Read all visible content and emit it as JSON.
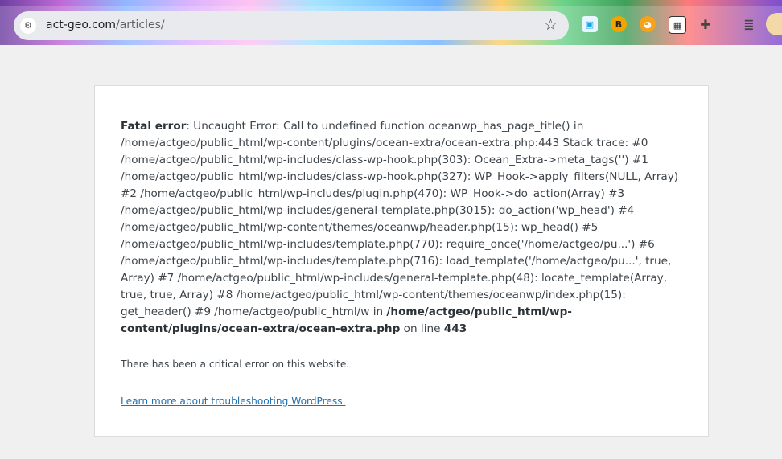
{
  "browser": {
    "url_host": "act-geo.com",
    "url_path": "/articles/",
    "extensions": [
      {
        "icon": "extension-icon-blue-square",
        "glyph": "▣",
        "color": "#1aa3e8"
      },
      {
        "icon": "extension-icon-b-badge",
        "glyph": "B",
        "color": "#f0a500"
      },
      {
        "icon": "extension-icon-orange-face",
        "glyph": "◕",
        "color": "#f7a21b"
      },
      {
        "icon": "extension-icon-qr",
        "glyph": "▦",
        "color": "#333333"
      },
      {
        "icon": "puzzle-piece-icon",
        "glyph": "✚",
        "color": "#444444"
      },
      {
        "icon": "media-playlist-icon",
        "glyph": "≣",
        "color": "#444444"
      }
    ]
  },
  "error": {
    "label": "Fatal error",
    "message": ": Uncaught Error: Call to undefined function oceanwp_has_page_title() in /home/actgeo/public_html/wp-content/plugins/ocean-extra/ocean-extra.php:443 Stack trace: #0 /home/actgeo/public_html/wp-includes/class-wp-hook.php(303): Ocean_Extra->meta_tags('') #1 /home/actgeo/public_html/wp-includes/class-wp-hook.php(327): WP_Hook->apply_filters(NULL, Array) #2 /home/actgeo/public_html/wp-includes/plugin.php(470): WP_Hook->do_action(Array) #3 /home/actgeo/public_html/wp-includes/general-template.php(3015): do_action('wp_head') #4 /home/actgeo/public_html/wp-content/themes/oceanwp/header.php(15): wp_head() #5 /home/actgeo/public_html/wp-includes/template.php(770): require_once('/home/actgeo/pu...') #6 /home/actgeo/public_html/wp-includes/template.php(716): load_template('/home/actgeo/pu...', true, Array) #7 /home/actgeo/public_html/wp-includes/general-template.php(48): locate_template(Array, true, true, Array) #8 /home/actgeo/public_html/wp-content/themes/oceanwp/index.php(15): get_header() #9 /home/actgeo/public_html/w in ",
    "file": "/home/actgeo/public_html/wp-content/plugins/ocean-extra/ocean-extra.php",
    "on_line_text": " on line ",
    "line": "443"
  },
  "notice": {
    "critical_text": "There has been a critical error on this website.",
    "learn_more_text": "Learn more about troubleshooting WordPress.",
    "link_color": "#2271b1"
  }
}
